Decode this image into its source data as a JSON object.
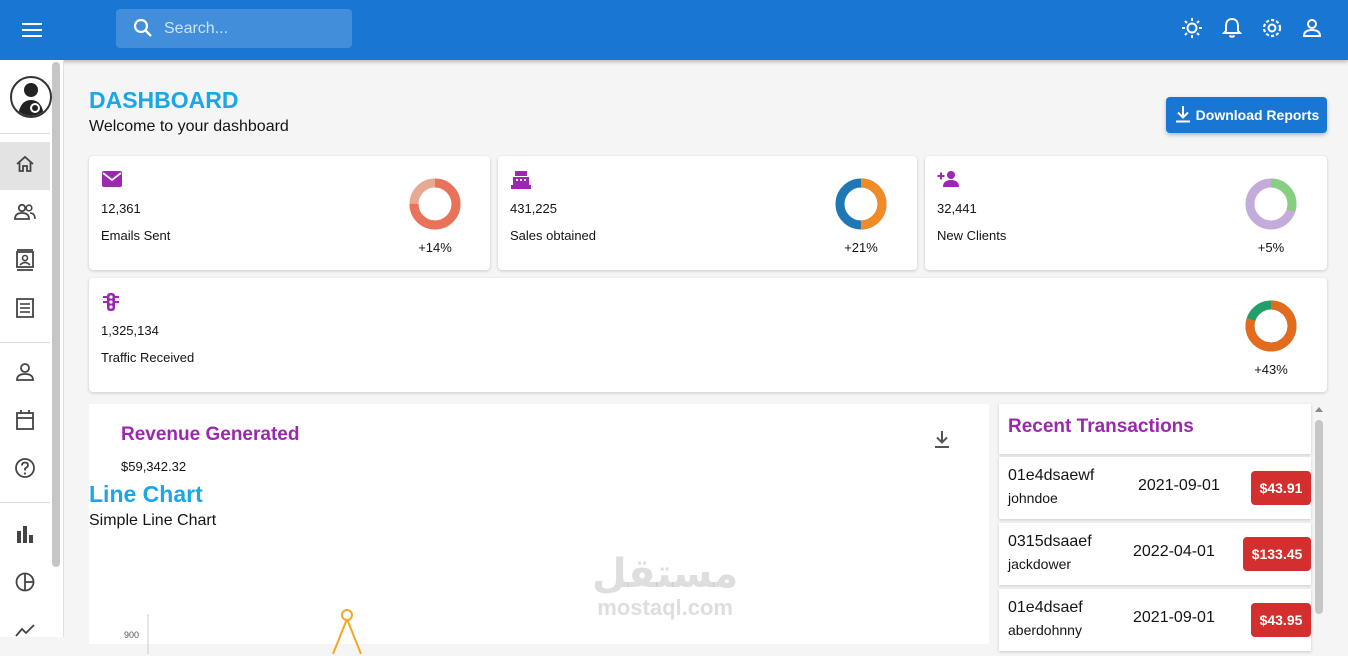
{
  "topbar": {
    "search_placeholder": "Search...",
    "icons": [
      "menu-icon",
      "light-mode-icon",
      "notifications-icon",
      "settings-icon",
      "person-icon"
    ]
  },
  "sidebar": {
    "icons": [
      "home-icon",
      "team-icon",
      "contacts-icon",
      "invoices-icon",
      "profile-icon",
      "calendar-icon",
      "faq-icon",
      "bar-chart-icon",
      "pie-chart-icon",
      "line-chart-icon"
    ]
  },
  "header": {
    "title": "DASHBOARD",
    "subtitle": "Welcome to your dashboard",
    "download_label": "Download Reports"
  },
  "stats": [
    {
      "value": "12,361",
      "label": "Emails Sent",
      "increase": "+14%",
      "icon": "email-icon",
      "progress": 0.75,
      "colors": [
        "#e8a993",
        "#e8725a"
      ]
    },
    {
      "value": "431,225",
      "label": "Sales obtained",
      "increase": "+21%",
      "icon": "point-of-sale-icon",
      "progress": 0.5,
      "colors": [
        "#1f77b4",
        "#f28a26"
      ]
    },
    {
      "value": "32,441",
      "label": "New Clients",
      "increase": "+5%",
      "icon": "person-add-icon",
      "progress": 0.3,
      "colors": [
        "#c3acd9",
        "#86cf80"
      ]
    },
    {
      "value": "1,325,134",
      "label": "Traffic Received",
      "increase": "+43%",
      "icon": "traffic-icon",
      "progress": 0.8,
      "colors": [
        "#229e6a",
        "#e26b1e"
      ]
    }
  ],
  "revenue": {
    "title": "Revenue Generated",
    "value": "$59,342.32",
    "chart_title": "Line Chart",
    "chart_subtitle": "Simple Line Chart",
    "visible_tick": "900"
  },
  "transactions": {
    "title": "Recent Transactions",
    "items": [
      {
        "txId": "01e4dsaewf",
        "user": "johndoe",
        "date": "2021-09-01",
        "cost": "$43.91"
      },
      {
        "txId": "0315dsaaef",
        "user": "jackdower",
        "date": "2022-04-01",
        "cost": "$133.45"
      },
      {
        "txId": "01e4dsaef",
        "user": "aberdohnny",
        "date": "2021-09-01",
        "cost": "$43.95"
      }
    ]
  },
  "watermark": {
    "arabic": "مستقل",
    "latin": "mostaql.com"
  },
  "colors": {
    "primary": "#1976d2",
    "accent_title": "#1aa7e8",
    "purple": "#9c27b0",
    "cost_red": "#d32f2f"
  }
}
